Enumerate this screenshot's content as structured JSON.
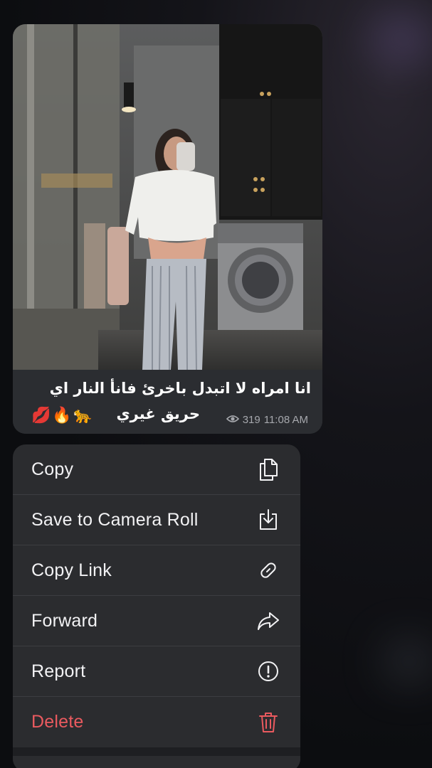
{
  "message": {
    "caption_line1": "انا امراه لا اتبدل باخرئ فانأ النار اي",
    "caption_line2": "حريق غيري",
    "emojis": "💋🔥🐆",
    "views": "319",
    "time": "11:08 AM"
  },
  "menu": {
    "items": [
      {
        "label": "Copy",
        "icon": "copy-icon"
      },
      {
        "label": "Save to Camera Roll",
        "icon": "save-download-icon"
      },
      {
        "label": "Copy Link",
        "icon": "link-icon"
      },
      {
        "label": "Forward",
        "icon": "forward-arrow-icon"
      },
      {
        "label": "Report",
        "icon": "exclamation-circle-icon"
      },
      {
        "label": "Delete",
        "icon": "trash-icon"
      }
    ]
  },
  "colors": {
    "background": "#0d0e11",
    "bubble": "#2b2d31",
    "menu": "#2b2c2f",
    "danger": "#ea5a5f",
    "meta_text": "#a6a8ad"
  }
}
